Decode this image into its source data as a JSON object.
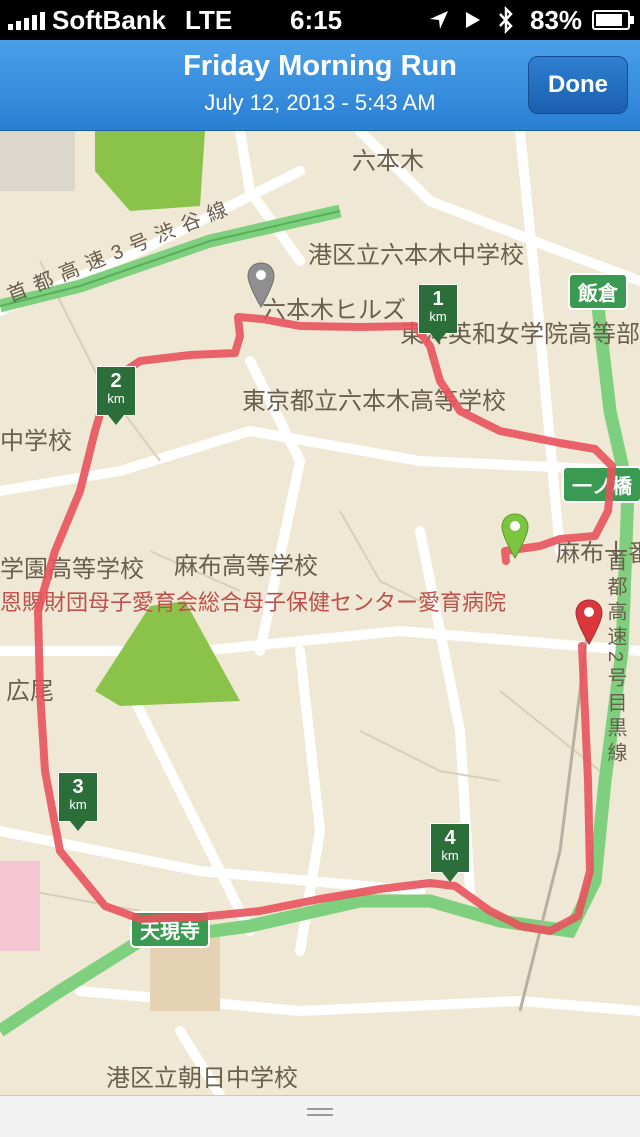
{
  "status": {
    "carrier": "SoftBank",
    "network": "LTE",
    "time": "6:15",
    "battery": "83%",
    "icons": [
      "signal-bars-icon",
      "location-arrow-icon",
      "play-icon",
      "bluetooth-icon",
      "battery-icon"
    ]
  },
  "header": {
    "title": "Friday Morning Run",
    "subtitle": "July 12, 2013 - 5:43 AM",
    "done_label": "Done"
  },
  "map": {
    "labels": {
      "roppongi": "六本木",
      "roppongi_jhs": "港区立六本木中学校",
      "hills": "六本木ヒルズ",
      "toyo_eiwa": "東洋英和女学院高等部",
      "roppongi_hs": "東京都立六本木高等学校",
      "jhs_left": "中学校",
      "gakuen_hs": "学園高等学校",
      "azabu_hs": "麻布高等学校",
      "aiiku_hospital": "恩賜財団母子愛育会総合母子保健センター愛育病院",
      "azabu_juban": "麻布十番",
      "hiroo": "広尾",
      "asahi_jhs": "港区立朝日中学校",
      "expressway_shibuya": "首都高速3号渋谷線",
      "expressway_meguro": "首都高速2号目黒線"
    },
    "road_signs": {
      "iikura": "飯倉",
      "ichinohashi": "一ノ橋",
      "tengenji": "天現寺"
    },
    "km_markers": [
      {
        "number": "1",
        "unit": "km"
      },
      {
        "number": "2",
        "unit": "km"
      },
      {
        "number": "3",
        "unit": "km"
      },
      {
        "number": "4",
        "unit": "km"
      }
    ],
    "pins": [
      "start-pin-icon",
      "finish-pin-icon",
      "gray-pin-icon"
    ],
    "colors": {
      "route": "#e8535d",
      "park": "#8bc34a",
      "expressway": "#7ed07e",
      "start_pin": "#7cc63f",
      "finish_pin": "#d9373c",
      "gray_pin": "#8f8f8f"
    }
  }
}
